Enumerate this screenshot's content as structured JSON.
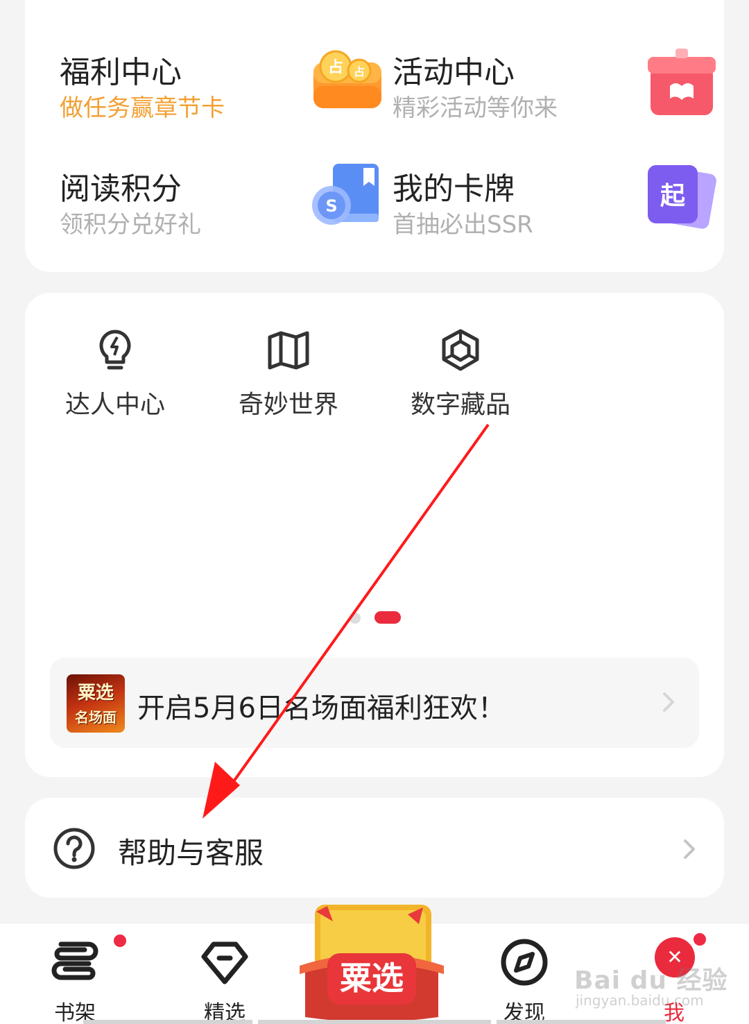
{
  "welfare": {
    "items": [
      {
        "title": "福利中心",
        "subtitle": "做任务赢章节卡",
        "icon": "coin-wallet-icon"
      },
      {
        "title": "活动中心",
        "subtitle": "精彩活动等你来",
        "icon": "gift-box-icon"
      },
      {
        "title": "阅读积分",
        "subtitle": "领积分兑好礼",
        "icon": "points-book-icon"
      },
      {
        "title": "我的卡牌",
        "subtitle": "首抽必出SSR",
        "icon": "card-deck-icon"
      }
    ],
    "card_icon_text": "起",
    "coin_icon_text": "占"
  },
  "shortcuts": {
    "items": [
      {
        "label": "达人中心",
        "icon": "lightbulb-icon"
      },
      {
        "label": "奇妙世界",
        "icon": "map-icon"
      },
      {
        "label": "数字藏品",
        "icon": "cube-icon"
      }
    ],
    "pager": {
      "pages": 2,
      "active": 2
    }
  },
  "banner": {
    "text": "开启5月6日名场面福利狂欢！",
    "thumb_lines": [
      "粟选",
      "名场面"
    ]
  },
  "help": {
    "label": "帮助与客服"
  },
  "bottom_nav": {
    "items": [
      {
        "label": "书架",
        "icon": "bookshelf-icon",
        "badge": true
      },
      {
        "label": "精选",
        "icon": "diamond-icon",
        "badge": false
      },
      {
        "label": "发现",
        "icon": "compass-icon",
        "badge": false
      },
      {
        "label": "我",
        "icon": "avatar-icon",
        "badge": true,
        "active": true
      }
    ],
    "center_promo_text": "粟选",
    "active_color": "#ea2b3d"
  },
  "watermark": {
    "line1": "Bai du 经验",
    "line2": "jingyan.baidu.com"
  },
  "colors": {
    "accent": "#ea2b3d",
    "orange_sub": "#f3a033",
    "annotation_arrow": "#ff1a1a"
  }
}
